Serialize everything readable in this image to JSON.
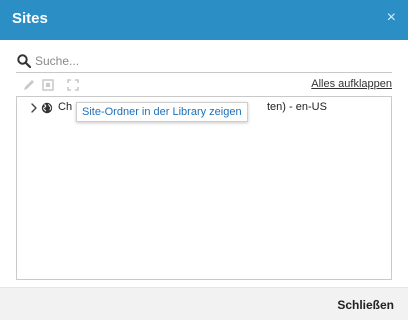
{
  "dialog": {
    "title": "Sites",
    "close_glyph": "×",
    "close_button_label": "Schließen"
  },
  "search": {
    "placeholder": "Suche..."
  },
  "toolbar": {
    "expand_all_label": "Alles aufklappen",
    "icons": [
      "pencil-icon",
      "square-icon",
      "expand-box-icon"
    ]
  },
  "tree": {
    "nodes": [
      {
        "label_prefix": "Ch",
        "label_suffix": "ten) - en-US"
      }
    ],
    "tooltip": "Site-Ordner in der Library zeigen"
  },
  "colors": {
    "header": "#2b8fc6",
    "tooltip_text": "#1d6fb8"
  }
}
